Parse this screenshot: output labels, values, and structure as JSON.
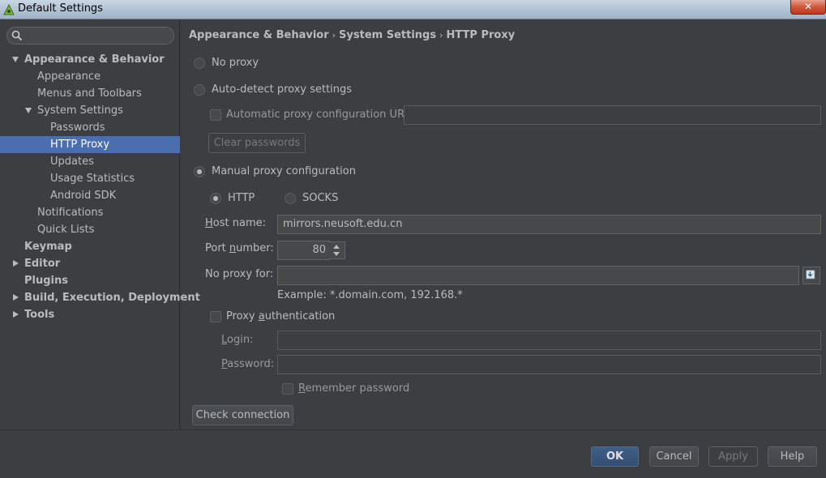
{
  "window": {
    "title": "Default Settings",
    "close_label": "✕"
  },
  "sidebar": {
    "search_placeholder": "",
    "items": [
      {
        "label": "Appearance & Behavior"
      },
      {
        "label": "Appearance"
      },
      {
        "label": "Menus and Toolbars"
      },
      {
        "label": "System Settings"
      },
      {
        "label": "Passwords"
      },
      {
        "label": "HTTP Proxy"
      },
      {
        "label": "Updates"
      },
      {
        "label": "Usage Statistics"
      },
      {
        "label": "Android SDK"
      },
      {
        "label": "Notifications"
      },
      {
        "label": "Quick Lists"
      },
      {
        "label": "Keymap"
      },
      {
        "label": "Editor"
      },
      {
        "label": "Plugins"
      },
      {
        "label": "Build, Execution, Deployment"
      },
      {
        "label": "Tools"
      }
    ]
  },
  "breadcrumb": {
    "part1": "Appearance & Behavior",
    "part2": "System Settings",
    "part3": "HTTP Proxy",
    "separator": "›"
  },
  "proxy": {
    "no_proxy": "No proxy",
    "auto_detect": "Auto-detect proxy settings",
    "auto_config_url": "Automatic proxy configuration URL:",
    "auto_config_url_value": "",
    "clear_passwords": "Clear passwords",
    "manual": "Manual proxy configuration",
    "http": "HTTP",
    "socks": "SOCKS",
    "host_label_u": "H",
    "host_label_rest": "ost name:",
    "host_value": "mirrors.neusoft.edu.cn",
    "port_label_a": "Port ",
    "port_label_u": "n",
    "port_label_b": "umber:",
    "port_value": "80",
    "no_proxy_for": "No proxy for:",
    "no_proxy_value": "",
    "example": "Example: *.domain.com, 192.168.*",
    "proxy_auth_a": "Proxy ",
    "proxy_auth_u": "a",
    "proxy_auth_b": "uthentication",
    "login_u": "L",
    "login_rest": "ogin:",
    "login_value": "",
    "password_u": "P",
    "password_rest": "assword:",
    "password_value": "",
    "remember_u": "R",
    "remember_rest": "emember password",
    "check_connection": "Check connection"
  },
  "footer": {
    "ok": "OK",
    "cancel": "Cancel",
    "apply": "Apply",
    "help": "Help"
  },
  "colors": {
    "background": "#3c3f41",
    "selection": "#4b6eaf",
    "text": "#bbbbbb"
  }
}
